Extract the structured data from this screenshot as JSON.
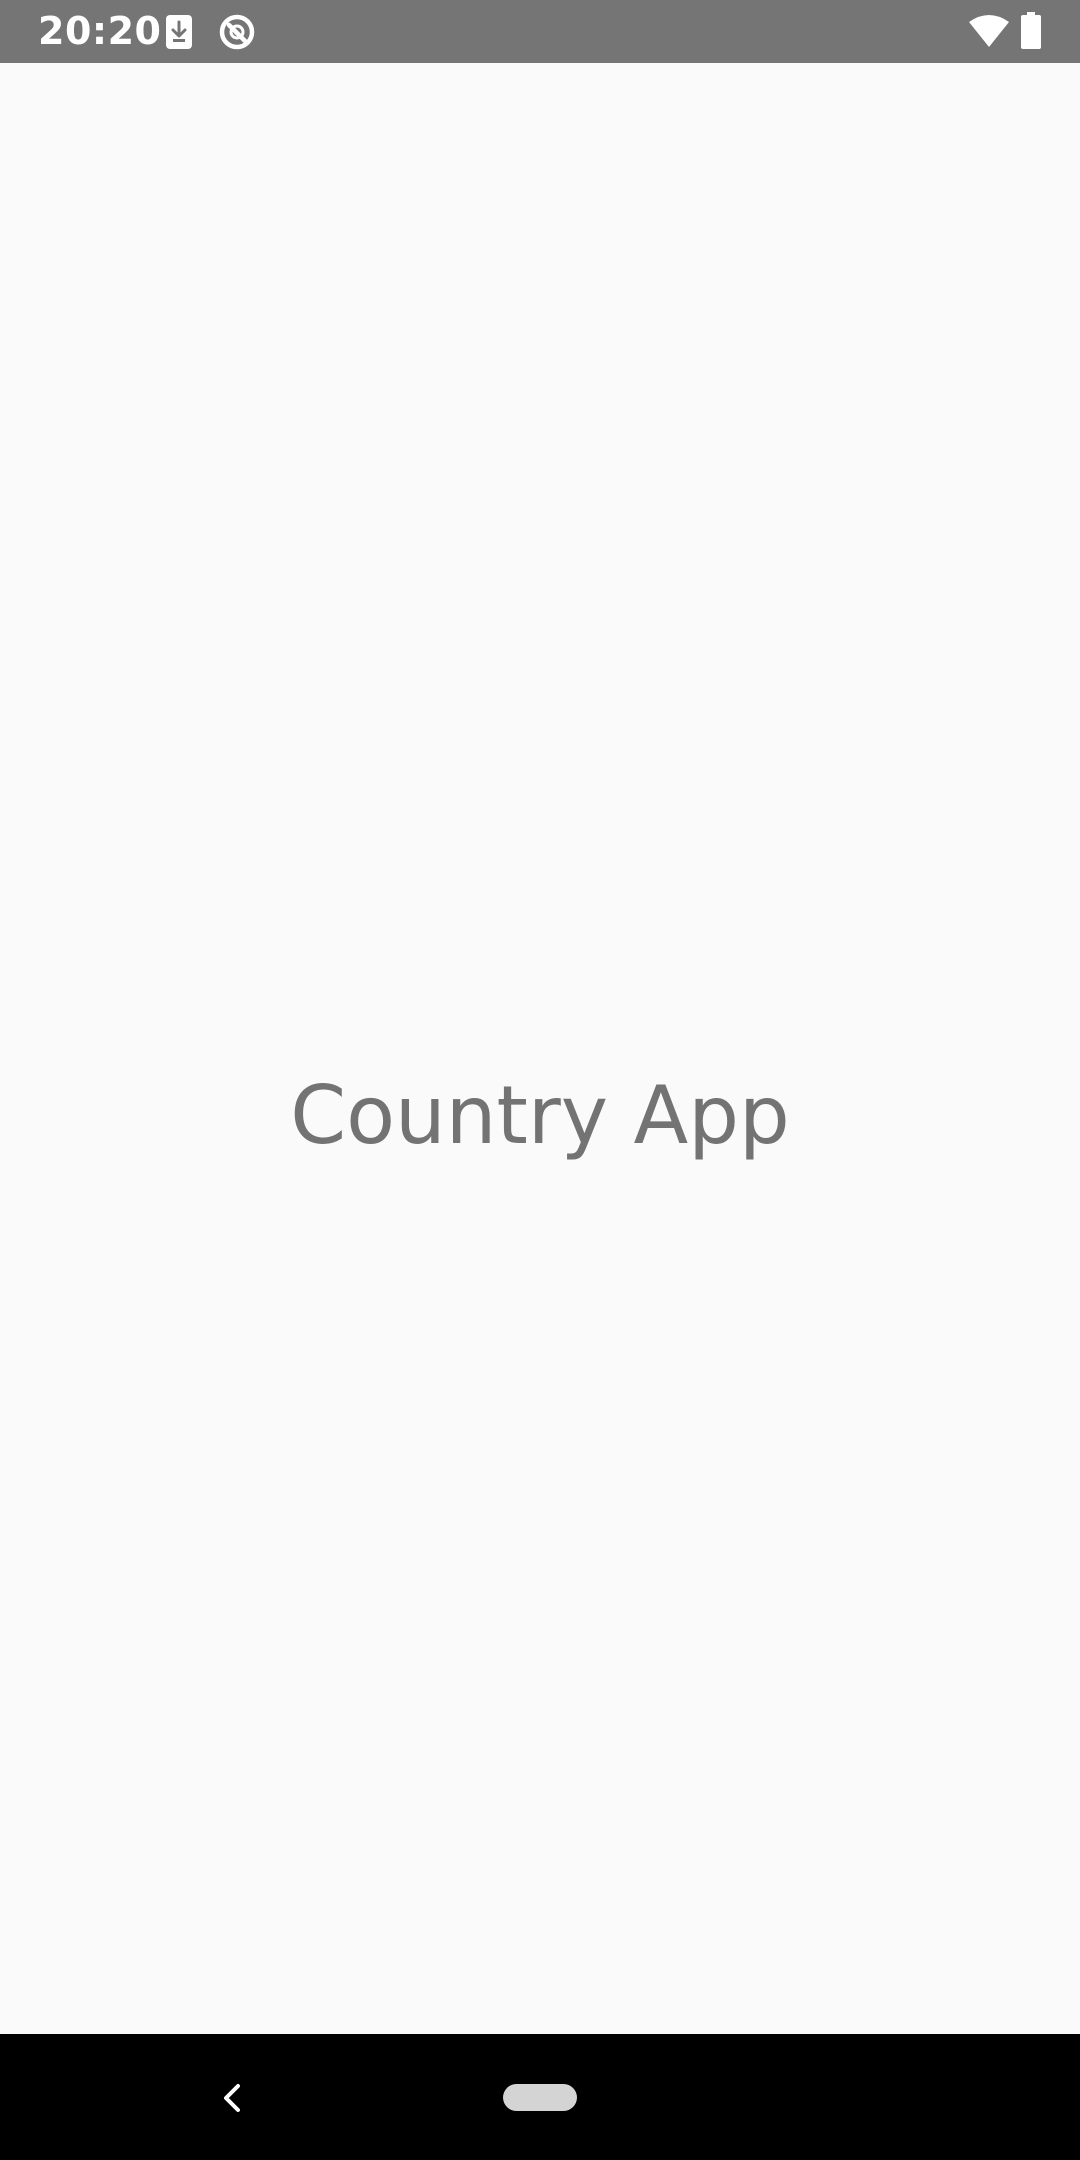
{
  "status_bar": {
    "time": "20:20",
    "icons": [
      "download-icon",
      "sync-icon",
      "wifi-icon",
      "battery-icon"
    ],
    "background": "#757575"
  },
  "main": {
    "title": "Country App",
    "title_color": "#737373",
    "background": "#fafafa"
  },
  "nav_bar": {
    "buttons": [
      "back-icon",
      "home-pill"
    ],
    "background": "#000000"
  }
}
